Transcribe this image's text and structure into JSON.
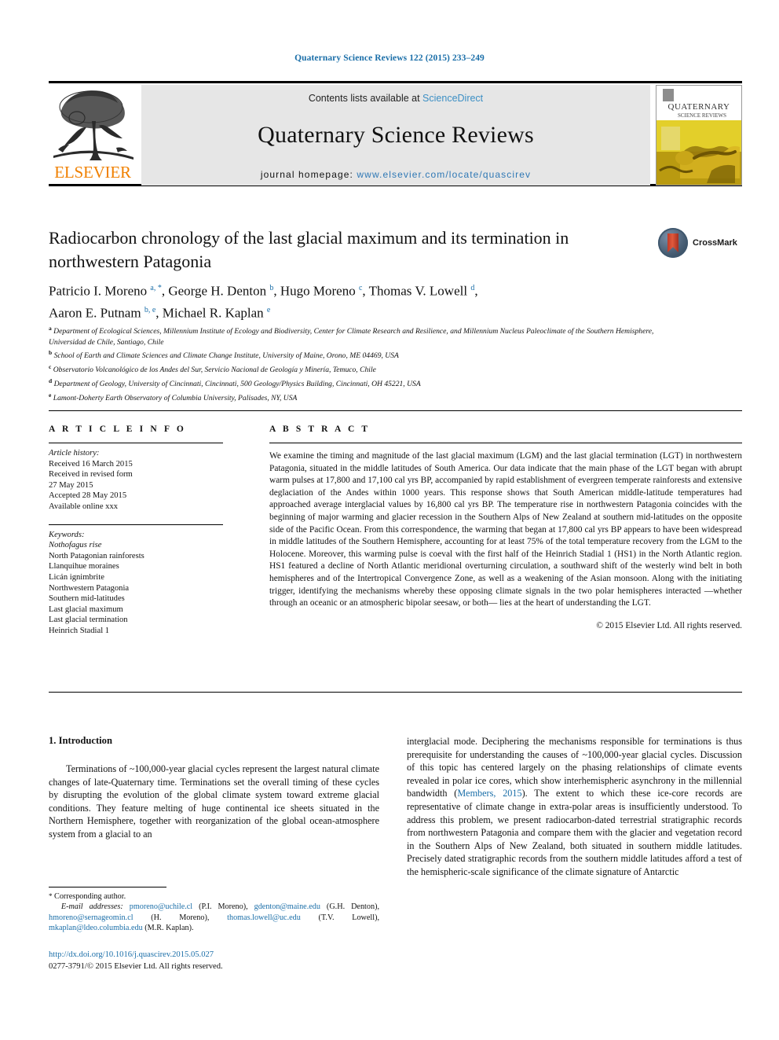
{
  "running_head": "Quaternary Science Reviews 122 (2015) 233–249",
  "masthead": {
    "contents_prefix": "Contents lists available at ",
    "sciencedirect": "ScienceDirect",
    "journal_title": "Quaternary Science Reviews",
    "homepage_label": "journal homepage: ",
    "homepage_url": "www.elsevier.com/locate/quascirev",
    "publisher": "ELSEVIER",
    "cover_title_line1": "QUATERNARY",
    "cover_title_line2": "SCIENCE REVIEWS"
  },
  "article": {
    "title": "Radiocarbon chronology of the last glacial maximum and its termination in northwestern Patagonia",
    "crossmark_label": "CrossMark",
    "authors_line1": "Patricio I. Moreno",
    "authors_html": "Patricio I. Moreno <sup>a, *</sup>, George H. Denton <sup>b</sup>, Hugo Moreno <sup>c</sup>, Thomas V. Lowell <sup>d</sup>, Aaron E. Putnam <sup>b, e</sup>, Michael R. Kaplan <sup>e</sup>",
    "affiliations": [
      {
        "marker": "a",
        "text": "Department of Ecological Sciences, Millennium Institute of Ecology and Biodiversity, Center for Climate Research and Resilience, and Millennium Nucleus Paleoclimate of the Southern Hemisphere, Universidad de Chile, Santiago, Chile"
      },
      {
        "marker": "b",
        "text": "School of Earth and Climate Sciences and Climate Change Institute, University of Maine, Orono, ME 04469, USA"
      },
      {
        "marker": "c",
        "text": "Observatorio Volcanológico de los Andes del Sur, Servicio Nacional de Geología y Minería, Temuco, Chile"
      },
      {
        "marker": "d",
        "text": "Department of Geology, University of Cincinnati, Cincinnati, 500 Geology/Physics Building, Cincinnati, OH 45221, USA"
      },
      {
        "marker": "e",
        "text": "Lamont-Doherty Earth Observatory of Columbia University, Palisades, NY, USA"
      }
    ]
  },
  "article_info": {
    "heading": "A R T I C L E  I N F O",
    "history_label": "Article history:",
    "history_lines": [
      "Received 16 March 2015",
      "Received in revised form",
      "27 May 2015",
      "Accepted 28 May 2015",
      "Available online xxx"
    ],
    "keywords_label": "Keywords:",
    "keywords": [
      "Nothofagus rise",
      "North Patagonian rainforests",
      "Llanquihue moraines",
      "Licán ignimbrite",
      "Northwestern Patagonia",
      "Southern mid-latitudes",
      "Last glacial maximum",
      "Last glacial termination",
      "Heinrich Stadial 1"
    ]
  },
  "abstract": {
    "heading": "A B S T R A C T",
    "text": "We examine the timing and magnitude of the last glacial maximum (LGM) and the last glacial termination (LGT) in northwestern Patagonia, situated in the middle latitudes of South America. Our data indicate that the main phase of the LGT began with abrupt warm pulses at 17,800 and 17,100 cal yrs BP, accompanied by rapid establishment of evergreen temperate rainforests and extensive deglaciation of the Andes within 1000 years. This response shows that South American middle-latitude temperatures had approached average interglacial values by 16,800 cal yrs BP. The temperature rise in northwestern Patagonia coincides with the beginning of major warming and glacier recession in the Southern Alps of New Zealand at southern mid-latitudes on the opposite side of the Pacific Ocean. From this correspondence, the warming that began at 17,800 cal yrs BP appears to have been widespread in middle latitudes of the Southern Hemisphere, accounting for at least 75% of the total temperature recovery from the LGM to the Holocene. Moreover, this warming pulse is coeval with the first half of the Heinrich Stadial 1 (HS1) in the North Atlantic region. HS1 featured a decline of North Atlantic meridional overturning circulation, a southward shift of the westerly wind belt in both hemispheres and of the Intertropical Convergence Zone, as well as a weakening of the Asian monsoon. Along with the initiating trigger, identifying the mechanisms whereby these opposing climate signals in the two polar hemispheres interacted —whether through an oceanic or an atmospheric bipolar seesaw, or both— lies at the heart of understanding the LGT.",
    "copyright": "© 2015 Elsevier Ltd. All rights reserved."
  },
  "introduction": {
    "heading": "1.  Introduction",
    "left_paragraph": "Terminations of ~100,000-year glacial cycles represent the largest natural climate changes of late-Quaternary time. Terminations set the overall timing of these cycles by disrupting the evolution of the global climate system toward extreme glacial conditions. They feature melting of huge continental ice sheets situated in the Northern Hemisphere, together with reorganization of the global ocean-atmosphere system from a glacial to an",
    "right_paragraph_part1": "interglacial mode. Deciphering the mechanisms responsible for terminations is thus prerequisite for understanding the causes of ~100,000-year glacial cycles. Discussion of this topic has centered largely on the phasing relationships of climate events revealed in polar ice cores, which show interhemispheric asynchrony in the millennial bandwidth (",
    "right_citation": "Members, 2015",
    "right_paragraph_part2": "). The extent to which these ice-core records are representative of climate change in extra-polar areas is insufficiently understood. To address this problem, we present radiocarbon-dated terrestrial stratigraphic records from northwestern Patagonia and compare them with the glacier and vegetation record in the Southern Alps of New Zealand, both situated in southern middle latitudes. Precisely dated stratigraphic records from the southern middle latitudes afford a test of the hemispheric-scale significance of the climate signature of Antarctic"
  },
  "footnotes": {
    "corresponding": "Corresponding author.",
    "email_label": "E-mail addresses:",
    "emails": [
      {
        "address": "pmoreno@uchile.cl",
        "owner": "(P.I. Moreno),"
      },
      {
        "address": "gdenton@maine.edu",
        "owner": "(G.H. Denton),"
      },
      {
        "address": "hmoreno@sernageomin.cl",
        "owner": "(H. Moreno),"
      },
      {
        "address": "thomas.lowell@uc.edu",
        "owner": "(T.V. Lowell),"
      },
      {
        "address": "mkaplan@ldeo.columbia.edu",
        "owner": "(M.R. Kaplan)."
      }
    ]
  },
  "doi": {
    "url": "http://dx.doi.org/10.1016/j.quascirev.2015.05.027",
    "issn_line": "0277-3791/© 2015 Elsevier Ltd. All rights reserved."
  },
  "colors": {
    "link": "#1a6ea8",
    "sciencedirect": "#3c8fc4",
    "elsevier_orange": "#f08000",
    "band_gray": "#e6e6e6"
  }
}
